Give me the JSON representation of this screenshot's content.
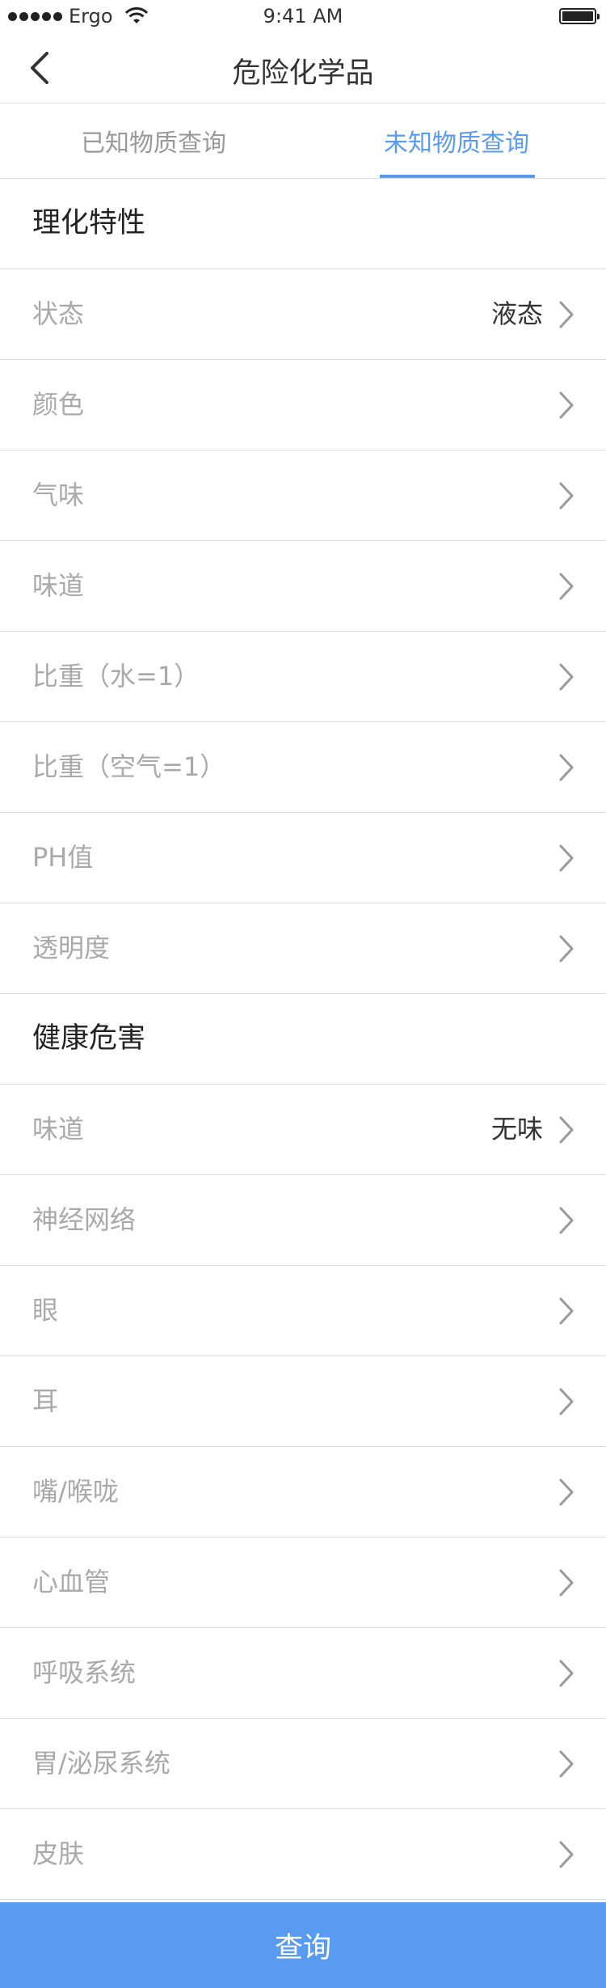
{
  "status_bar": {
    "carrier": "Ergo",
    "time": "9:41 AM"
  },
  "nav": {
    "title": "危险化学品",
    "back_icon": "chevron-left-icon"
  },
  "tabs": [
    {
      "label": "已知物质查询",
      "active": false
    },
    {
      "label": "未知物质查询",
      "active": true
    }
  ],
  "colors": {
    "accent": "#5a9bf2",
    "divider": "#dddddd",
    "label_gray": "#a9a9a9"
  },
  "sections": [
    {
      "title": "理化特性",
      "items": [
        {
          "label": "状态",
          "value": "液态"
        },
        {
          "label": "颜色",
          "value": ""
        },
        {
          "label": "气味",
          "value": ""
        },
        {
          "label": "味道",
          "value": ""
        },
        {
          "label": "比重（水=1）",
          "value": ""
        },
        {
          "label": "比重（空气=1）",
          "value": ""
        },
        {
          "label": "PH值",
          "value": ""
        },
        {
          "label": "透明度",
          "value": ""
        }
      ]
    },
    {
      "title": "健康危害",
      "items": [
        {
          "label": "味道",
          "value": "无味"
        },
        {
          "label": "神经网络",
          "value": ""
        },
        {
          "label": "眼",
          "value": ""
        },
        {
          "label": "耳",
          "value": ""
        },
        {
          "label": "嘴/喉咙",
          "value": ""
        },
        {
          "label": "心血管",
          "value": ""
        },
        {
          "label": "呼吸系统",
          "value": ""
        },
        {
          "label": "胃/泌尿系统",
          "value": ""
        },
        {
          "label": "皮肤",
          "value": ""
        }
      ]
    }
  ],
  "footer": {
    "query_label": "查询"
  }
}
